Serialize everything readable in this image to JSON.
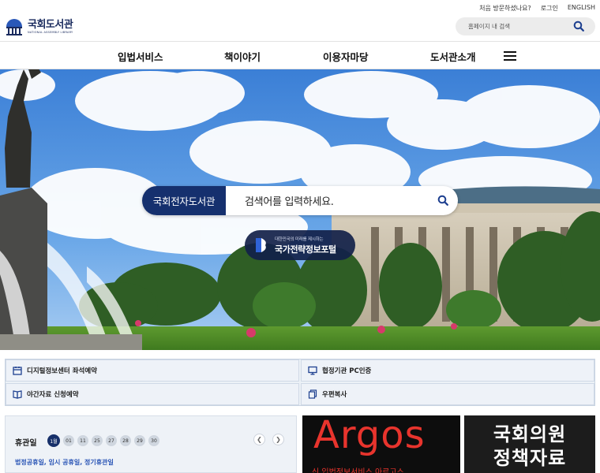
{
  "header": {
    "logo_ko": "국회도서관",
    "logo_en": "NATIONAL ASSEMBLY LIBRARY",
    "util_links": [
      "처음 방문하셨나요?",
      "로그인",
      "ENGLISH"
    ],
    "search_placeholder": "홈페이지 내 검색"
  },
  "nav": {
    "items": [
      "입법서비스",
      "책이야기",
      "이용자마당",
      "도서관소개"
    ]
  },
  "hero": {
    "search_label": "국회전자도서관",
    "search_placeholder": "검색어를 입력하세요.",
    "portal_tagline": "대한민국의 미래를 제시하는",
    "portal_name": "국가전략정보포털"
  },
  "quick_menu": [
    {
      "label": "디지털정보센터 좌석예약",
      "icon": "calendar-icon"
    },
    {
      "label": "협정기관 PC인증",
      "icon": "monitor-icon"
    },
    {
      "label": "야간자료 신청예약",
      "icon": "book-icon"
    },
    {
      "label": "우편복사",
      "icon": "copy-icon"
    }
  ],
  "holiday": {
    "title": "휴관일",
    "days": [
      "1월",
      "01",
      "11",
      "25",
      "27",
      "28",
      "29",
      "30"
    ],
    "note": "법정공휴일, 임시 공휴일, 정기휴관일"
  },
  "banners": {
    "argos_title": "Argos",
    "argos_sub": "신 입법정보서비스 아르고스",
    "policy_line1": "국회의원",
    "policy_line2": "정책자료"
  },
  "colors": {
    "brand_navy": "#15306e",
    "argos_red": "#e8342d",
    "link_blue": "#2b56b6"
  }
}
